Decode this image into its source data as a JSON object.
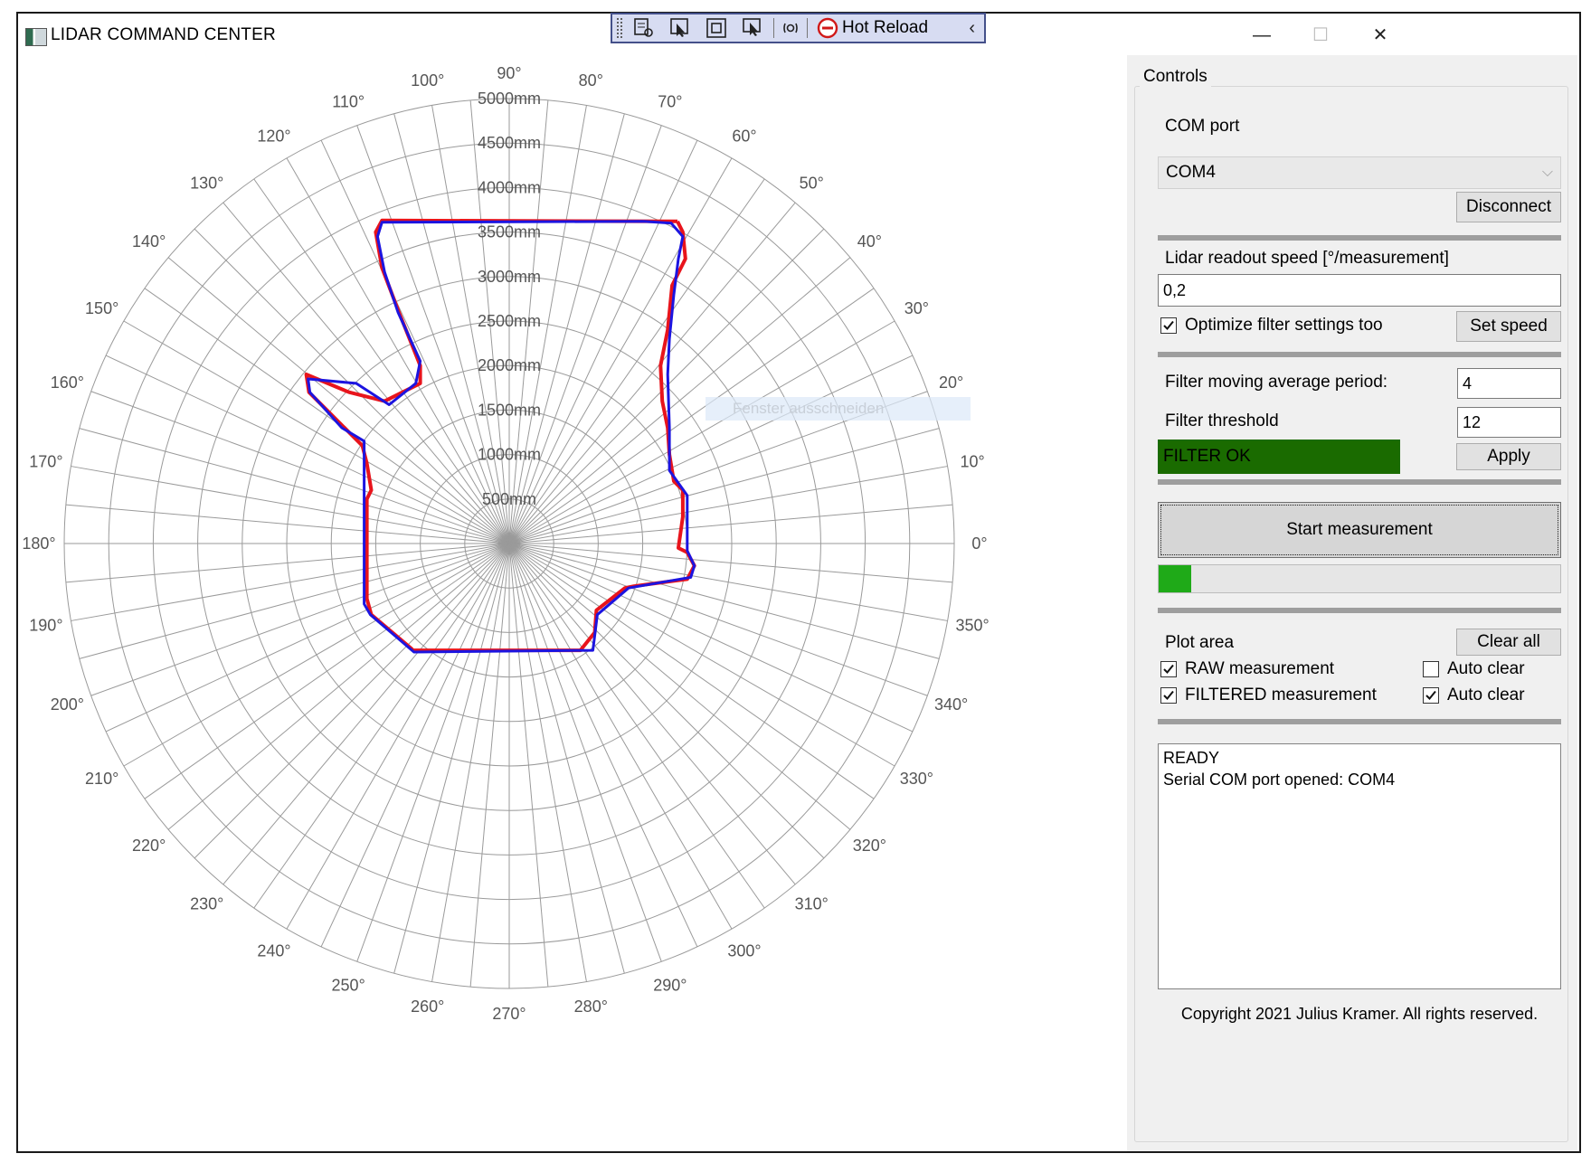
{
  "window": {
    "title": "LIDAR COMMAND CENTER",
    "controls": {
      "minimize": "—",
      "maximize": "☐",
      "close": "✕"
    }
  },
  "hot_reload_bar": {
    "label": "Hot Reload",
    "icons": [
      "select-element-icon",
      "pointer-icon",
      "layout-adorner-icon",
      "track-focus-icon",
      "xaml-reload-icon",
      "stop-icon",
      "collapse-chevron-icon"
    ]
  },
  "controls": {
    "group_title": "Controls",
    "com_port_label": "COM port",
    "com_port_value": "COM4",
    "disconnect_label": "Disconnect",
    "readout_label": "Lidar readout speed [°/measurement]",
    "readout_value": "0,2",
    "optimize_label": "Optimize filter settings too",
    "optimize_checked": true,
    "set_speed_label": "Set speed",
    "ma_period_label": "Filter moving average period:",
    "ma_period_value": "4",
    "threshold_label": "Filter threshold",
    "threshold_value": "12",
    "filter_status": "FILTER OK",
    "filter_status_color": "#1a6b00",
    "apply_label": "Apply",
    "start_label": "Start measurement",
    "progress": 0.08,
    "progress_color": "#1faa18",
    "plot_area_label": "Plot area",
    "clear_all_label": "Clear all",
    "raw_label": "RAW measurement",
    "raw_checked": true,
    "raw_auto_clear_label": "Auto clear",
    "raw_auto_clear_checked": false,
    "filtered_label": "FILTERED measurement",
    "filtered_checked": true,
    "filtered_auto_clear_label": "Auto clear",
    "filtered_auto_clear_checked": true,
    "log_lines": [
      "READY",
      "Serial COM port opened: COM4"
    ],
    "copyright": "Copyright 2021 Julius Kramer. All rights reserved."
  },
  "ghost_tooltip": "Fenster ausschneiden",
  "chart_data": {
    "type": "polar",
    "r_unit": "mm",
    "r_max": 5000,
    "r_ticks": [
      500,
      1000,
      1500,
      2000,
      2500,
      3000,
      3500,
      4000,
      4500,
      5000
    ],
    "r_tick_labels": [
      "500mm",
      "1000mm",
      "1500mm",
      "2000mm",
      "2500mm",
      "3000mm",
      "3500mm",
      "4000mm",
      "4500mm",
      "5000mm"
    ],
    "angle_ticks": [
      0,
      10,
      20,
      30,
      40,
      50,
      60,
      70,
      80,
      90,
      100,
      110,
      120,
      130,
      140,
      150,
      160,
      170,
      180,
      190,
      200,
      210,
      220,
      230,
      240,
      250,
      260,
      270,
      280,
      290,
      300,
      310,
      320,
      330,
      340,
      350
    ],
    "angle_tick_labels": [
      "0°",
      "10°",
      "20°",
      "30°",
      "40°",
      "50°",
      "60°",
      "70°",
      "80°",
      "90°",
      "100°",
      "110°",
      "120°",
      "130°",
      "140°",
      "150°",
      "160°",
      "170°",
      "180°",
      "190°",
      "200°",
      "210°",
      "220°",
      "230°",
      "240°",
      "250°",
      "260°",
      "270°",
      "280°",
      "290°",
      "300°",
      "310°",
      "320°",
      "330°",
      "340°",
      "350°"
    ],
    "spoke_step_deg": 5,
    "grid": true,
    "series": [
      {
        "color": "#e8141c",
        "xy_mm": [
          [
            1890,
            3620
          ],
          [
            -1430,
            3630
          ],
          [
            -1500,
            3500
          ],
          [
            -1430,
            3100
          ],
          [
            -1240,
            2600
          ],
          [
            -1000,
            2000
          ],
          [
            -1000,
            1800
          ],
          [
            -1400,
            1600
          ],
          [
            -1800,
            1700
          ],
          [
            -2280,
            1900
          ],
          [
            -2250,
            1700
          ],
          [
            -2000,
            1450
          ],
          [
            -1650,
            1100
          ],
          [
            -1600,
            900
          ],
          [
            -1550,
            600
          ],
          [
            -1600,
            500
          ],
          [
            -1600,
            -620
          ],
          [
            -1550,
            -800
          ],
          [
            -1100,
            -1180
          ],
          [
            -1080,
            -1200
          ],
          [
            800,
            -1200
          ],
          [
            960,
            -1000
          ],
          [
            980,
            -750
          ],
          [
            1300,
            -500
          ],
          [
            1400,
            -480
          ],
          [
            2000,
            -400
          ],
          [
            2080,
            -250
          ],
          [
            2000,
            -100
          ],
          [
            1900,
            -50
          ],
          [
            1950,
            300
          ],
          [
            1950,
            600
          ],
          [
            1850,
            700
          ],
          [
            1800,
            1000
          ],
          [
            1780,
            1300
          ],
          [
            1720,
            1600
          ],
          [
            1700,
            2000
          ],
          [
            1780,
            2400
          ],
          [
            1830,
            2900
          ],
          [
            1980,
            3200
          ],
          [
            1950,
            3500
          ],
          [
            1890,
            3620
          ]
        ]
      },
      {
        "color": "#1c14e0",
        "xy_mm": [
          [
            1510,
            3620
          ],
          [
            -1430,
            3610
          ],
          [
            -1480,
            3450
          ],
          [
            -1400,
            3050
          ],
          [
            -1250,
            2600
          ],
          [
            -1000,
            2050
          ],
          [
            -1050,
            1800
          ],
          [
            -1350,
            1560
          ],
          [
            -1720,
            1800
          ],
          [
            -2260,
            1850
          ],
          [
            -2240,
            1700
          ],
          [
            -1880,
            1300
          ],
          [
            -1630,
            1150
          ],
          [
            -1630,
            900
          ],
          [
            -1630,
            -680
          ],
          [
            -1560,
            -800
          ],
          [
            -1070,
            -1220
          ],
          [
            940,
            -1200
          ],
          [
            990,
            -800
          ],
          [
            1340,
            -500
          ],
          [
            2040,
            -380
          ],
          [
            2080,
            -250
          ],
          [
            2000,
            -80
          ],
          [
            2000,
            540
          ],
          [
            1800,
            820
          ],
          [
            1800,
            1300
          ],
          [
            1780,
            1900
          ],
          [
            1800,
            2300
          ],
          [
            1850,
            2800
          ],
          [
            1900,
            3200
          ],
          [
            1950,
            3450
          ],
          [
            1820,
            3600
          ],
          [
            1510,
            3620
          ]
        ]
      }
    ]
  }
}
